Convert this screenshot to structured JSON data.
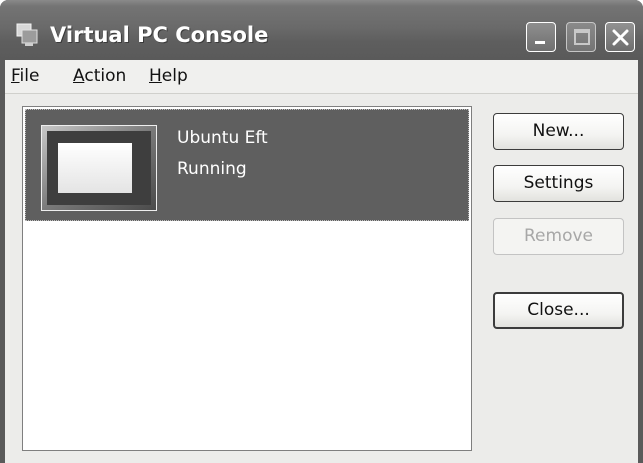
{
  "window": {
    "title": "Virtual PC Console",
    "controls": {
      "minimize_icon": "minimize-icon",
      "maximize_icon": "maximize-icon",
      "close_icon": "close-icon"
    }
  },
  "menu": {
    "file": {
      "accel": "F",
      "rest": "ile"
    },
    "action": {
      "accel": "A",
      "rest": "ction"
    },
    "help": {
      "accel": "H",
      "rest": "elp"
    }
  },
  "vm_list": {
    "items": [
      {
        "name": "Ubuntu Eft",
        "status": "Running",
        "selected": true
      }
    ]
  },
  "buttons": {
    "new": "New...",
    "settings": "Settings",
    "remove": "Remove",
    "close": "Close..."
  },
  "colors": {
    "titlebar": "#6a6a6a",
    "selection": "#5f5f5f",
    "client_bg": "#ececea",
    "disabled_text": "#a7a7a7"
  }
}
